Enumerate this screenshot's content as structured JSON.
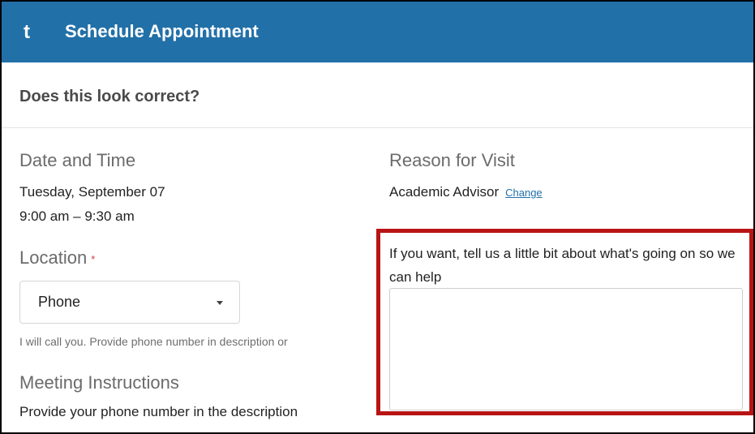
{
  "header": {
    "title": "Schedule Appointment",
    "back_glyph": "t"
  },
  "confirm": {
    "title": "Does this look correct?"
  },
  "date_time": {
    "heading": "Date and Time",
    "date": "Tuesday, September 07",
    "time": "9:00 am – 9:30 am"
  },
  "reason": {
    "heading": "Reason for Visit",
    "value": "Academic Advisor",
    "change_label": "Change"
  },
  "location": {
    "heading": "Location",
    "required_mark": "*",
    "selected": "Phone",
    "note": "I will call you. Provide phone number in description or"
  },
  "meeting": {
    "heading": "Meeting Instructions",
    "text": "Provide your phone number in the description"
  },
  "description": {
    "prompt": "If you want, tell us a little bit about what's going on so we can help",
    "value": ""
  },
  "colors": {
    "header_bg": "#2270a8",
    "highlight": "#b91414",
    "required": "#d04040",
    "link": "#2270a8"
  }
}
